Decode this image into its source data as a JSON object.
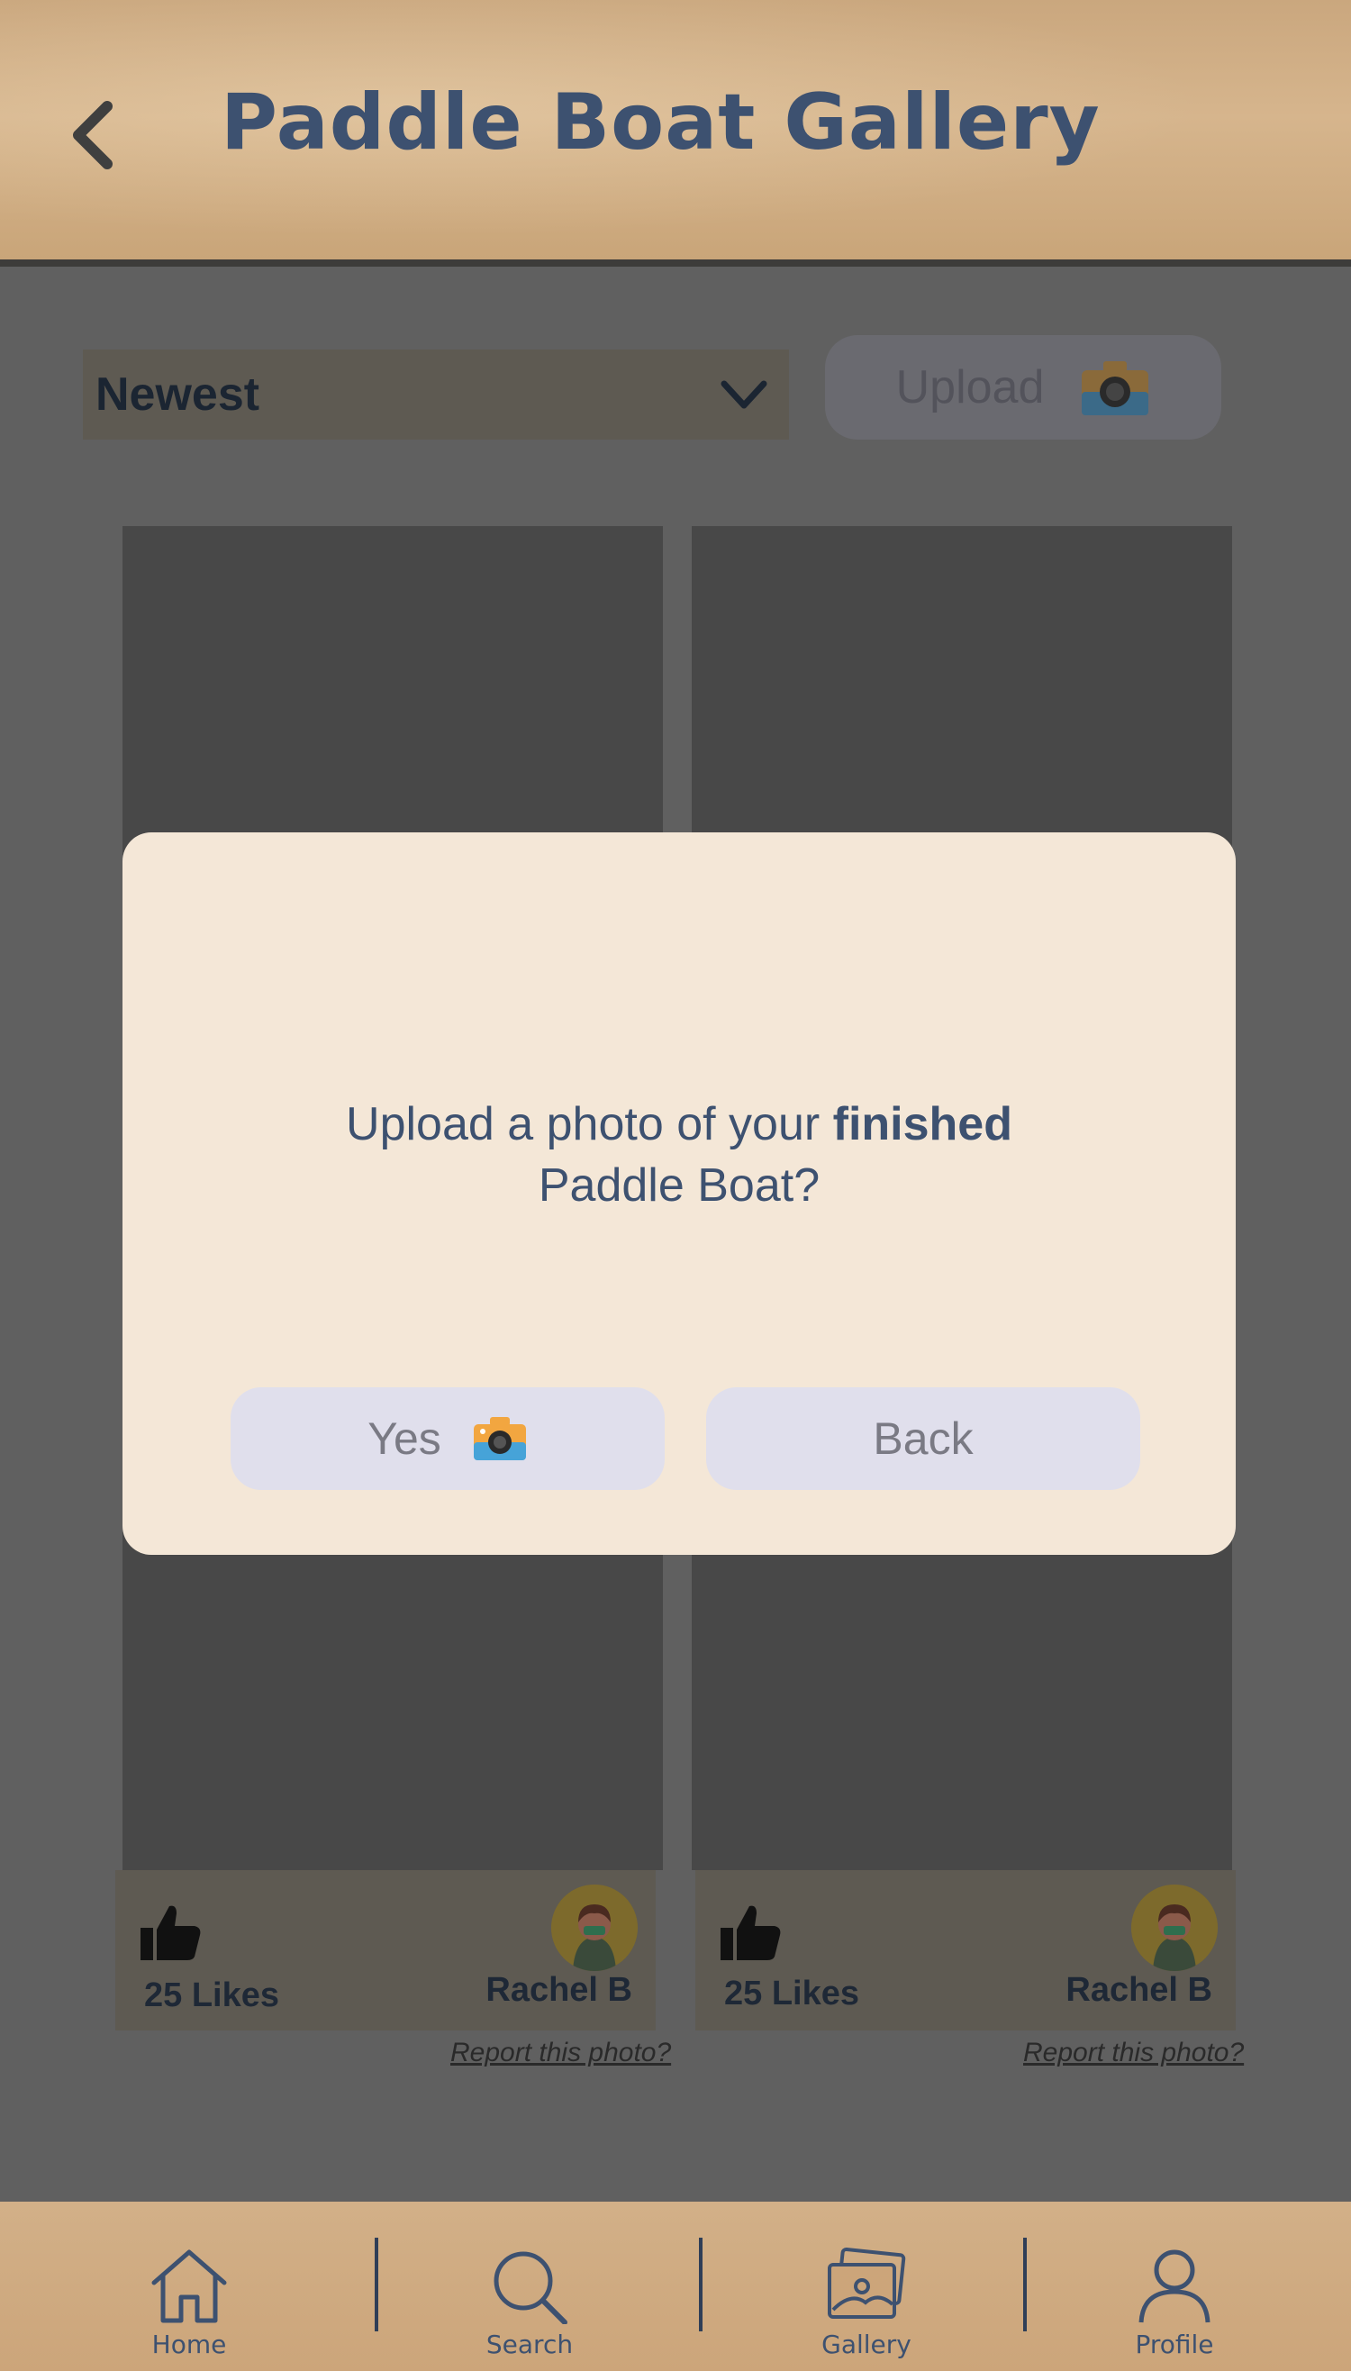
{
  "header": {
    "title": "Paddle Boat Gallery"
  },
  "toolbar": {
    "sort_value": "Newest",
    "upload_label": "Upload"
  },
  "gallery": {
    "cards": [
      {
        "likes": "25 Likes",
        "user": "Rachel B",
        "report": "Report this photo?"
      },
      {
        "likes": "25 Likes",
        "user": "Rachel B",
        "report": "Report this photo?"
      }
    ]
  },
  "modal": {
    "text_part1": "Upload a photo of your ",
    "text_bold": "finished",
    "text_part2": "Paddle Boat?",
    "yes_label": "Yes",
    "back_label": "Back"
  },
  "nav": {
    "items": [
      {
        "label": "Home",
        "icon": "home-icon"
      },
      {
        "label": "Search",
        "icon": "search-icon"
      },
      {
        "label": "Gallery",
        "icon": "gallery-icon"
      },
      {
        "label": "Profile",
        "icon": "profile-icon"
      }
    ]
  },
  "colors": {
    "title": "#3d5170",
    "overlay": "#606060",
    "modal_bg": "#f4e7d7",
    "button_bg": "#e0dfec"
  }
}
